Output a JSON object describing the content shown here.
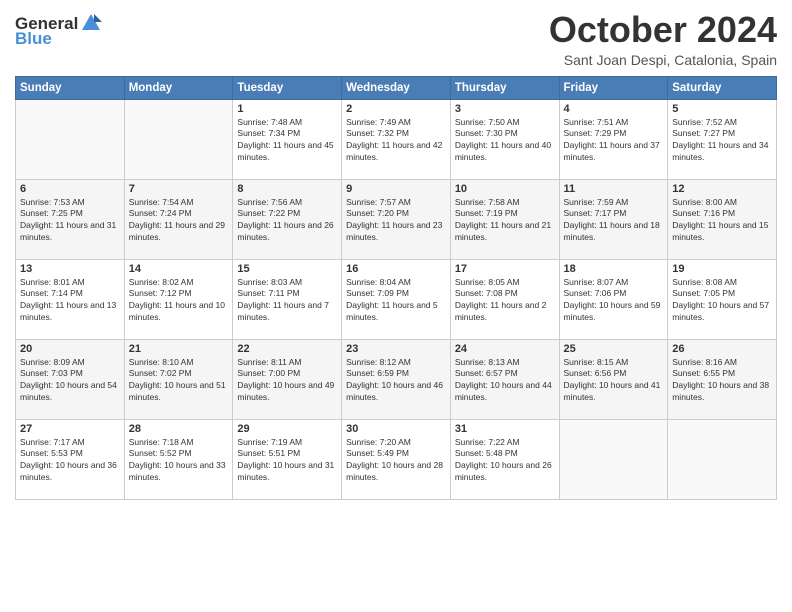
{
  "logo": {
    "general": "General",
    "blue": "Blue"
  },
  "title": "October 2024",
  "subtitle": "Sant Joan Despi, Catalonia, Spain",
  "days_of_week": [
    "Sunday",
    "Monday",
    "Tuesday",
    "Wednesday",
    "Thursday",
    "Friday",
    "Saturday"
  ],
  "weeks": [
    [
      {
        "day": "",
        "sunrise": "",
        "sunset": "",
        "daylight": ""
      },
      {
        "day": "",
        "sunrise": "",
        "sunset": "",
        "daylight": ""
      },
      {
        "day": "1",
        "sunrise": "Sunrise: 7:48 AM",
        "sunset": "Sunset: 7:34 PM",
        "daylight": "Daylight: 11 hours and 45 minutes."
      },
      {
        "day": "2",
        "sunrise": "Sunrise: 7:49 AM",
        "sunset": "Sunset: 7:32 PM",
        "daylight": "Daylight: 11 hours and 42 minutes."
      },
      {
        "day": "3",
        "sunrise": "Sunrise: 7:50 AM",
        "sunset": "Sunset: 7:30 PM",
        "daylight": "Daylight: 11 hours and 40 minutes."
      },
      {
        "day": "4",
        "sunrise": "Sunrise: 7:51 AM",
        "sunset": "Sunset: 7:29 PM",
        "daylight": "Daylight: 11 hours and 37 minutes."
      },
      {
        "day": "5",
        "sunrise": "Sunrise: 7:52 AM",
        "sunset": "Sunset: 7:27 PM",
        "daylight": "Daylight: 11 hours and 34 minutes."
      }
    ],
    [
      {
        "day": "6",
        "sunrise": "Sunrise: 7:53 AM",
        "sunset": "Sunset: 7:25 PM",
        "daylight": "Daylight: 11 hours and 31 minutes."
      },
      {
        "day": "7",
        "sunrise": "Sunrise: 7:54 AM",
        "sunset": "Sunset: 7:24 PM",
        "daylight": "Daylight: 11 hours and 29 minutes."
      },
      {
        "day": "8",
        "sunrise": "Sunrise: 7:56 AM",
        "sunset": "Sunset: 7:22 PM",
        "daylight": "Daylight: 11 hours and 26 minutes."
      },
      {
        "day": "9",
        "sunrise": "Sunrise: 7:57 AM",
        "sunset": "Sunset: 7:20 PM",
        "daylight": "Daylight: 11 hours and 23 minutes."
      },
      {
        "day": "10",
        "sunrise": "Sunrise: 7:58 AM",
        "sunset": "Sunset: 7:19 PM",
        "daylight": "Daylight: 11 hours and 21 minutes."
      },
      {
        "day": "11",
        "sunrise": "Sunrise: 7:59 AM",
        "sunset": "Sunset: 7:17 PM",
        "daylight": "Daylight: 11 hours and 18 minutes."
      },
      {
        "day": "12",
        "sunrise": "Sunrise: 8:00 AM",
        "sunset": "Sunset: 7:16 PM",
        "daylight": "Daylight: 11 hours and 15 minutes."
      }
    ],
    [
      {
        "day": "13",
        "sunrise": "Sunrise: 8:01 AM",
        "sunset": "Sunset: 7:14 PM",
        "daylight": "Daylight: 11 hours and 13 minutes."
      },
      {
        "day": "14",
        "sunrise": "Sunrise: 8:02 AM",
        "sunset": "Sunset: 7:12 PM",
        "daylight": "Daylight: 11 hours and 10 minutes."
      },
      {
        "day": "15",
        "sunrise": "Sunrise: 8:03 AM",
        "sunset": "Sunset: 7:11 PM",
        "daylight": "Daylight: 11 hours and 7 minutes."
      },
      {
        "day": "16",
        "sunrise": "Sunrise: 8:04 AM",
        "sunset": "Sunset: 7:09 PM",
        "daylight": "Daylight: 11 hours and 5 minutes."
      },
      {
        "day": "17",
        "sunrise": "Sunrise: 8:05 AM",
        "sunset": "Sunset: 7:08 PM",
        "daylight": "Daylight: 11 hours and 2 minutes."
      },
      {
        "day": "18",
        "sunrise": "Sunrise: 8:07 AM",
        "sunset": "Sunset: 7:06 PM",
        "daylight": "Daylight: 10 hours and 59 minutes."
      },
      {
        "day": "19",
        "sunrise": "Sunrise: 8:08 AM",
        "sunset": "Sunset: 7:05 PM",
        "daylight": "Daylight: 10 hours and 57 minutes."
      }
    ],
    [
      {
        "day": "20",
        "sunrise": "Sunrise: 8:09 AM",
        "sunset": "Sunset: 7:03 PM",
        "daylight": "Daylight: 10 hours and 54 minutes."
      },
      {
        "day": "21",
        "sunrise": "Sunrise: 8:10 AM",
        "sunset": "Sunset: 7:02 PM",
        "daylight": "Daylight: 10 hours and 51 minutes."
      },
      {
        "day": "22",
        "sunrise": "Sunrise: 8:11 AM",
        "sunset": "Sunset: 7:00 PM",
        "daylight": "Daylight: 10 hours and 49 minutes."
      },
      {
        "day": "23",
        "sunrise": "Sunrise: 8:12 AM",
        "sunset": "Sunset: 6:59 PM",
        "daylight": "Daylight: 10 hours and 46 minutes."
      },
      {
        "day": "24",
        "sunrise": "Sunrise: 8:13 AM",
        "sunset": "Sunset: 6:57 PM",
        "daylight": "Daylight: 10 hours and 44 minutes."
      },
      {
        "day": "25",
        "sunrise": "Sunrise: 8:15 AM",
        "sunset": "Sunset: 6:56 PM",
        "daylight": "Daylight: 10 hours and 41 minutes."
      },
      {
        "day": "26",
        "sunrise": "Sunrise: 8:16 AM",
        "sunset": "Sunset: 6:55 PM",
        "daylight": "Daylight: 10 hours and 38 minutes."
      }
    ],
    [
      {
        "day": "27",
        "sunrise": "Sunrise: 7:17 AM",
        "sunset": "Sunset: 5:53 PM",
        "daylight": "Daylight: 10 hours and 36 minutes."
      },
      {
        "day": "28",
        "sunrise": "Sunrise: 7:18 AM",
        "sunset": "Sunset: 5:52 PM",
        "daylight": "Daylight: 10 hours and 33 minutes."
      },
      {
        "day": "29",
        "sunrise": "Sunrise: 7:19 AM",
        "sunset": "Sunset: 5:51 PM",
        "daylight": "Daylight: 10 hours and 31 minutes."
      },
      {
        "day": "30",
        "sunrise": "Sunrise: 7:20 AM",
        "sunset": "Sunset: 5:49 PM",
        "daylight": "Daylight: 10 hours and 28 minutes."
      },
      {
        "day": "31",
        "sunrise": "Sunrise: 7:22 AM",
        "sunset": "Sunset: 5:48 PM",
        "daylight": "Daylight: 10 hours and 26 minutes."
      },
      {
        "day": "",
        "sunrise": "",
        "sunset": "",
        "daylight": ""
      },
      {
        "day": "",
        "sunrise": "",
        "sunset": "",
        "daylight": ""
      }
    ]
  ]
}
